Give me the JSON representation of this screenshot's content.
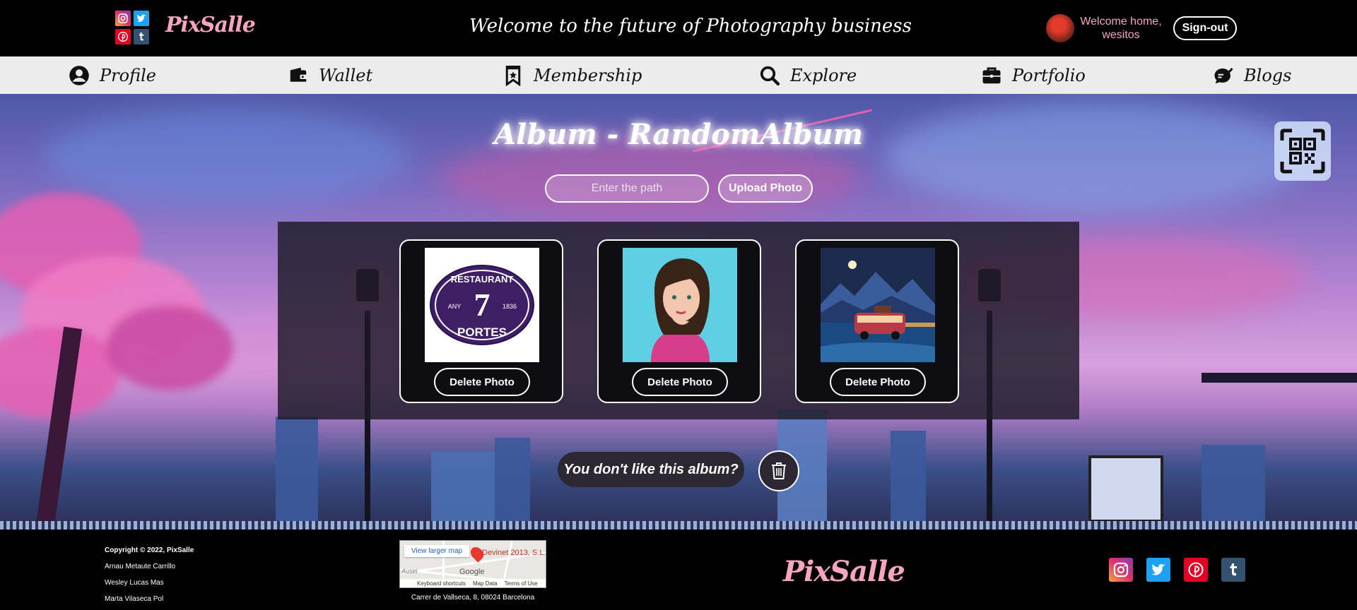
{
  "header": {
    "brand": "PixSalle",
    "welcome_banner": "Welcome to the future of Photography business",
    "greeting_line1": "Welcome home,",
    "greeting_line2": "wesitos",
    "signout_label": "Sign-out",
    "social": [
      "instagram-icon",
      "twitter-icon",
      "pinterest-icon",
      "tumblr-icon"
    ]
  },
  "nav": {
    "items": [
      {
        "label": "Profile",
        "icon": "user-circle-icon"
      },
      {
        "label": "Wallet",
        "icon": "wallet-icon"
      },
      {
        "label": "Membership",
        "icon": "bookmark-star-icon"
      },
      {
        "label": "Explore",
        "icon": "search-icon"
      },
      {
        "label": "Portfolio",
        "icon": "briefcase-icon"
      },
      {
        "label": "Blogs",
        "icon": "blog-feather-icon"
      }
    ]
  },
  "album": {
    "title": "Album - RandomAlbum",
    "path_placeholder": "Enter the path",
    "path_value": "",
    "upload_label": "Upload Photo",
    "photos": [
      {
        "subject": "restaurant-logo",
        "logo_top": "RESTAURANT",
        "logo_number": "7",
        "logo_left": "ANY",
        "logo_right": "1836",
        "logo_bottom": "PORTES",
        "delete_label": "Delete Photo"
      },
      {
        "subject": "girl-portrait",
        "delete_label": "Delete Photo"
      },
      {
        "subject": "van-mountains",
        "delete_label": "Delete Photo"
      }
    ],
    "dislike_text": "You don't like this album?"
  },
  "footer": {
    "copyright": "Copyright © 2022, PixSalle",
    "authors": [
      "Arnau Metaute Carrillo",
      "Wesley Lucas Mas",
      "Marta Vilaseca Pol"
    ],
    "map": {
      "link_label": "View larger map",
      "place": "Devinet 2013, S.L.",
      "provider": "Google",
      "street_fragment": "Ausei",
      "links": [
        "Keyboard shortcuts",
        "Map Data",
        "Terms of Use"
      ]
    },
    "address": "Carrer de Vallseca, 8, 08024 Barcelona",
    "brand": "PixSalle"
  },
  "colors": {
    "brand_pink": "#f6a4c0",
    "nav_bg": "#ececec",
    "instagram": "#c13584",
    "twitter": "#1da1f2",
    "pinterest": "#e60023",
    "tumblr": "#34526f"
  }
}
